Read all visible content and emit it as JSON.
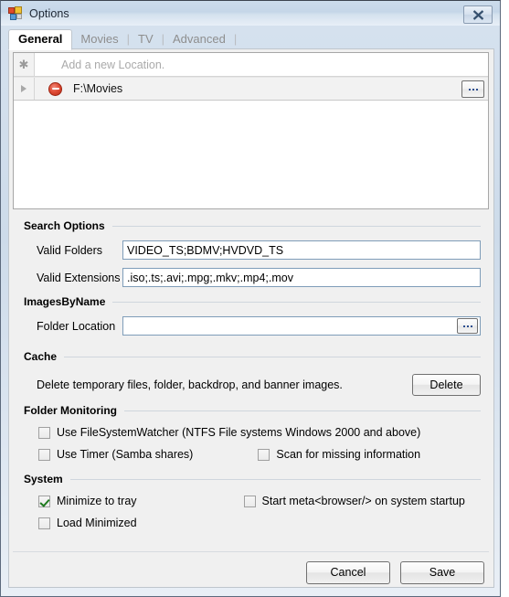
{
  "window": {
    "title": "Options",
    "app_icon": "app-squares-icon",
    "close_icon": "close-icon",
    "close_label": "Close"
  },
  "tabs": [
    {
      "label": "General",
      "active": true
    },
    {
      "label": "Movies",
      "active": false
    },
    {
      "label": "TV",
      "active": false
    },
    {
      "label": "Advanced",
      "active": false
    }
  ],
  "grid": {
    "new_row": {
      "indicator": "asterisk-icon",
      "placeholder": "Add a new Location."
    },
    "rows": [
      {
        "indicator": "row-arrow-icon",
        "delete_icon": "remove-circle-icon",
        "path": "F:\\Movies",
        "browse_label": "..."
      }
    ]
  },
  "search_options": {
    "title": "Search Options",
    "valid_folders": {
      "label": "Valid Folders",
      "value": "VIDEO_TS;BDMV;HVDVD_TS"
    },
    "valid_extensions": {
      "label": "Valid Extensions",
      "value": ".iso;.ts;.avi;.mpg;.mkv;.mp4;.mov"
    }
  },
  "images_by_name": {
    "title": "ImagesByName",
    "folder_location": {
      "label": "Folder Location",
      "value": "",
      "browse_label": "..."
    }
  },
  "cache": {
    "title": "Cache",
    "description": "Delete temporary files, folder, backdrop, and banner images.",
    "delete_label": "Delete"
  },
  "folder_monitoring": {
    "title": "Folder Monitoring",
    "options": [
      {
        "label": "Use FileSystemWatcher (NTFS File systems Windows 2000 and above)",
        "checked": false
      },
      {
        "label": "Use Timer (Samba shares)",
        "checked": false
      },
      {
        "label": "Scan for missing information",
        "checked": false
      }
    ]
  },
  "system": {
    "title": "System",
    "options": [
      {
        "label": "Minimize to tray",
        "checked": true
      },
      {
        "label": "Start meta<browser/> on system startup",
        "checked": false
      },
      {
        "label": "Load Minimized",
        "checked": false
      }
    ]
  },
  "footer": {
    "cancel_label": "Cancel",
    "save_label": "Save"
  },
  "colors": {
    "titlebar_top": "#ccdcec",
    "body": "#f0f0f0",
    "grid_bg": "#ffffff",
    "textbox_border": "#7f9db9",
    "delete_icon": "#df4b35",
    "check": "#1f7a1f"
  }
}
